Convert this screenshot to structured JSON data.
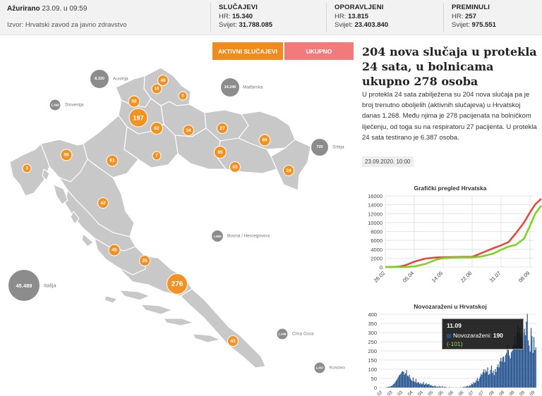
{
  "header": {
    "updated_label": "Ažurirano",
    "updated_value": "23.09. u 09:59",
    "source": "Izvor: Hrvatski zavod za javno zdravstvo",
    "cases": {
      "title": "SLUČAJEVI",
      "hr_label": "HR:",
      "hr": "15.340",
      "world_label": "Svijet:",
      "world": "31.788.085"
    },
    "recovered": {
      "title": "OPORAVLJENI",
      "hr_label": "HR:",
      "hr": "13.815",
      "world_label": "Svijet:",
      "world": "23.403.840"
    },
    "deaths": {
      "title": "PREMINULI",
      "hr_label": "HR:",
      "hr": "257",
      "world_label": "Svijet:",
      "world": "975.551"
    }
  },
  "toggles": {
    "active": "AKTIVNI SLUČAJEVI",
    "total": "UKUPNO"
  },
  "colors": {
    "accent": "#f08c1e",
    "total_button": "#f27a7a",
    "map_land": "#c8c8c8",
    "cases_line": "#e8483e",
    "recovered_line": "#7ed321",
    "bars": "#1f4e8c"
  },
  "map": {
    "county_counts": [
      "48",
      "10",
      "5",
      "58",
      "197",
      "82",
      "34",
      "27",
      "69",
      "56",
      "3",
      "61",
      "7",
      "85",
      "63",
      "24",
      "42",
      "45",
      "25",
      "276",
      "43"
    ],
    "neighbors": [
      {
        "count": "8.330",
        "name": "Austrija"
      },
      {
        "count": "1.368",
        "name": "Slovenija"
      },
      {
        "count": "14.246",
        "name": "Mađarska"
      },
      {
        "count": "720",
        "name": "Srbija"
      },
      {
        "count": "1.600",
        "name": "Bosna i Hercegovina"
      },
      {
        "count": "45.489",
        "name": "Italija"
      },
      {
        "count": "1.446",
        "name": "Crna Gora"
      },
      {
        "count": "1.467",
        "name": "Kosovo"
      }
    ]
  },
  "article": {
    "headline": "204 nova slučaja u protekla 24 sata, u bolnicama ukupno 278 osoba",
    "body": "U protekla 24 sata zabilježena su 204 nova slučaja pa je broj trenutno oboljelih (aktivnih slučajeva) u Hrvatskoj danas 1.268. Među njima je 278 pacijenata na bolničkom liječenju, od toga su na respiratoru 27 pacijenta. U protekla 24 sata testirano je 6.387 osoba.",
    "timestamp": "23.09.2020. 10:00"
  },
  "chart_data": [
    {
      "type": "line",
      "title": "Grafički pregled Hrvatska",
      "x_ticks": [
        "26.02",
        "05.04",
        "14.05",
        "22.06",
        "31.07",
        "08.09"
      ],
      "ylim": [
        0,
        16000
      ],
      "y_ticks": [
        "0",
        "2000",
        "4000",
        "6000",
        "8000",
        "10000",
        "12000",
        "14000",
        "16000"
      ],
      "grid": true,
      "series": [
        {
          "color": "#e8483e",
          "x": [
            "26.02",
            "15.03",
            "25.03",
            "05.04",
            "20.04",
            "05.05",
            "14.05",
            "01.06",
            "22.06",
            "05.07",
            "20.07",
            "31.07",
            "10.08",
            "20.08",
            "31.08",
            "08.09",
            "15.09",
            "23.09"
          ],
          "values": [
            0,
            60,
            440,
            1200,
            1900,
            2150,
            2200,
            2245,
            2280,
            3150,
            4200,
            4880,
            5600,
            7600,
            10050,
            12300,
            14100,
            15340
          ]
        },
        {
          "color": "#7ed321",
          "x": [
            "26.02",
            "15.03",
            "25.03",
            "05.04",
            "20.04",
            "05.05",
            "14.05",
            "01.06",
            "22.06",
            "05.07",
            "20.07",
            "31.07",
            "10.08",
            "20.08",
            "31.08",
            "08.09",
            "15.09",
            "23.09"
          ],
          "values": [
            0,
            0,
            20,
            150,
            700,
            1700,
            2000,
            2120,
            2160,
            2400,
            3000,
            3900,
            4600,
            5000,
            6400,
            9300,
            12000,
            13815
          ]
        }
      ]
    },
    {
      "type": "bar",
      "title": "Novozaraženi u Hrvatskoj",
      "ylim": [
        0,
        400
      ],
      "y_ticks": [
        "0",
        "50",
        "100",
        "150",
        "200",
        "250",
        "300",
        "350",
        "400"
      ],
      "x_ticks": [
        "02",
        "03",
        "03",
        "04",
        "04",
        "05",
        "05",
        "06",
        "06",
        "07",
        "07",
        "08",
        "08",
        "09",
        "09",
        "09"
      ],
      "values": [
        0,
        0,
        0,
        0,
        0,
        0,
        1,
        2,
        3,
        4,
        6,
        5,
        9,
        12,
        18,
        22,
        30,
        38,
        45,
        55,
        65,
        70,
        76,
        85,
        91,
        86,
        71,
        79,
        96,
        65,
        60,
        70,
        52,
        42,
        35,
        55,
        35,
        30,
        48,
        25,
        30,
        28,
        20,
        25,
        18,
        22,
        30,
        15,
        20,
        24,
        16,
        18,
        20,
        11,
        14,
        10,
        8,
        6,
        12,
        7,
        4,
        6,
        3,
        9,
        5,
        2,
        8,
        1,
        4,
        3,
        2,
        1,
        0,
        2,
        1,
        0,
        1,
        0,
        1,
        0,
        0,
        1,
        0,
        0,
        0,
        2,
        1,
        0,
        4,
        2,
        6,
        3,
        8,
        10,
        5,
        13,
        12,
        22,
        18,
        30,
        25,
        28,
        40,
        52,
        35,
        48,
        60,
        75,
        70,
        84,
        100,
        80,
        95,
        86,
        110,
        70,
        74,
        96,
        120,
        80,
        92,
        68,
        100,
        86,
        112,
        128,
        110,
        144,
        162,
        142,
        166,
        170,
        140,
        178,
        190,
        235,
        205,
        175,
        160,
        192,
        200,
        228,
        236,
        280,
        232,
        300,
        340,
        300,
        326,
        295,
        275,
        262,
        300,
        322,
        285,
        360,
        402,
        258,
        230,
        196,
        325,
        280,
        190,
        275,
        205,
        220
      ],
      "tooltip": {
        "date": "11.09",
        "series": "Novozaraženi:",
        "value": "190",
        "delta": "(-101)"
      }
    }
  ]
}
